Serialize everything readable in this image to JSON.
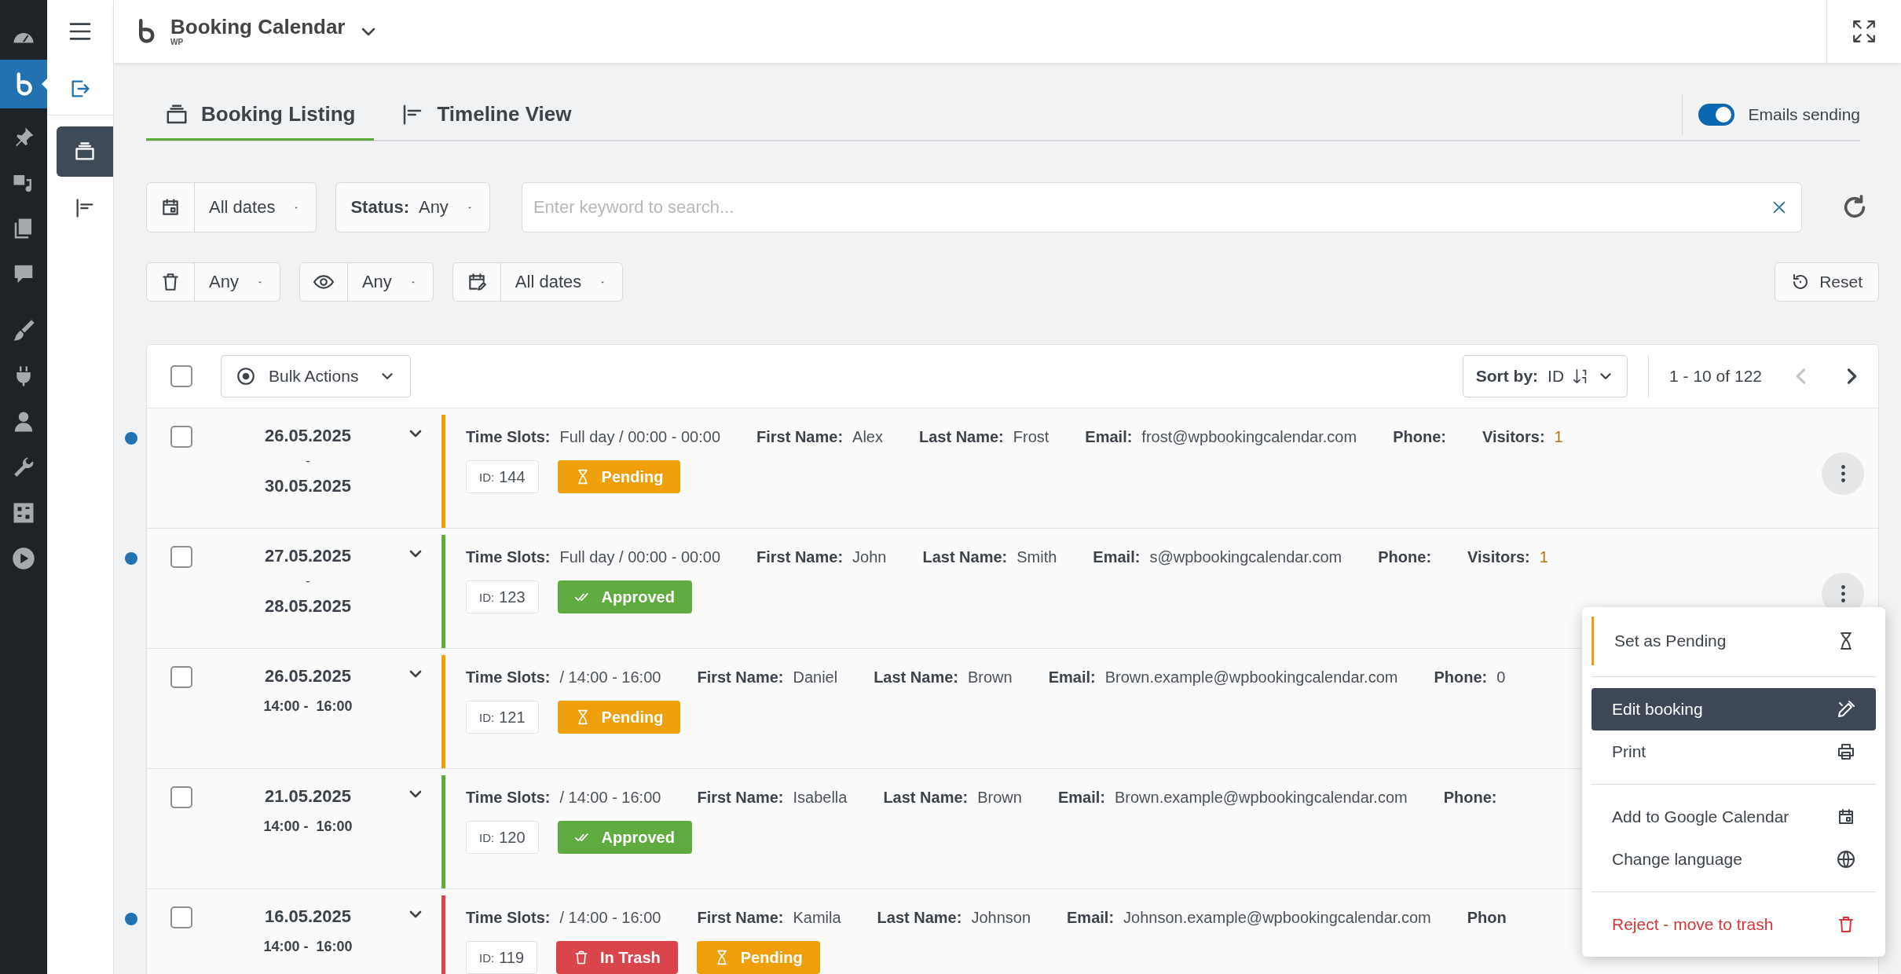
{
  "wp_menu": [
    {
      "selected": false
    },
    {
      "selected": true
    },
    {
      "selected": false
    },
    {
      "selected": false
    },
    {
      "selected": false
    },
    {
      "selected": false
    },
    {
      "selected": false
    },
    {
      "selected": false
    },
    {
      "selected": false
    },
    {
      "selected": false
    },
    {
      "selected": false
    },
    {
      "selected": false
    }
  ],
  "side_menu": [
    {
      "selected": false
    },
    {
      "selected": true
    },
    {
      "selected": false
    }
  ],
  "header": {
    "title": "Booking Calendar",
    "subtitle": "WP"
  },
  "tabs": [
    {
      "label": "Booking Listing",
      "selected": true
    },
    {
      "label": "Timeline View",
      "selected": false
    }
  ],
  "emails_toggle": {
    "label": "Emails sending",
    "on": true
  },
  "filters": {
    "dates": "All dates",
    "status_label": "Status:",
    "status": "Any",
    "search": {
      "placeholder": "Enter keyword to search..."
    },
    "trash": "Any",
    "read": "Any",
    "modified": "All dates",
    "reset": "Reset"
  },
  "list": {
    "select_all_checked": false,
    "bulk_actions": "Bulk Actions",
    "sort_label": "Sort by:",
    "sort_value": "ID",
    "pagination": "1 - 10 of 122",
    "rows": [
      {
        "unread": true,
        "checked": false,
        "kind": "range",
        "date": "26.05.2025",
        "separator": "-",
        "end": "30.05.2025",
        "color": "#ef9f0b",
        "fields": [
          {
            "label": "Time Slots:",
            "value": "Full day / 00:00 - 00:00"
          },
          {
            "label": "First Name:",
            "value": "Alex"
          },
          {
            "label": "Last Name:",
            "value": "Frost"
          },
          {
            "label": "Email:",
            "value": "frost@wpbookingcalendar.com"
          },
          {
            "label": "Phone:"
          },
          {
            "label": "Visitors:",
            "value": "1"
          }
        ],
        "id_label": "ID:",
        "id": "144",
        "badges": [
          {
            "label": "Pending",
            "kind": "pending"
          }
        ],
        "more_button": true
      },
      {
        "unread": true,
        "checked": false,
        "kind": "range",
        "date": "27.05.2025",
        "separator": "-",
        "end": "28.05.2025",
        "color": "#5fab3f",
        "fields": [
          {
            "label": "Time Slots:",
            "value": "Full day / 00:00 - 00:00"
          },
          {
            "label": "First Name:",
            "value": "John"
          },
          {
            "label": "Last Name:",
            "value": "Smith"
          },
          {
            "label": "Email:",
            "value": "s@wpbookingcalendar.com"
          },
          {
            "label": "Phone:"
          },
          {
            "label": "Visitors:",
            "value": "1"
          }
        ],
        "id_label": "ID:",
        "id": "123",
        "badges": [
          {
            "label": "Approved",
            "kind": "approved"
          }
        ],
        "more_button": true
      },
      {
        "unread": false,
        "checked": false,
        "kind": "single",
        "date": "26.05.2025",
        "time": "14:00 -  16:00",
        "color": "#ef9f0b",
        "fields": [
          {
            "label": "Time Slots:",
            "value": "/ 14:00 - 16:00"
          },
          {
            "label": "First Name:",
            "value": "Daniel"
          },
          {
            "label": "Last Name:",
            "value": "Brown"
          },
          {
            "label": "Email:",
            "value": "Brown.example@wpbookingcalendar.com"
          },
          {
            "label": "Phone:",
            "value": "0"
          }
        ],
        "id_label": "ID:",
        "id": "121",
        "badges": [
          {
            "label": "Pending",
            "kind": "pending"
          }
        ],
        "more_button": false
      },
      {
        "unread": false,
        "checked": false,
        "kind": "single",
        "date": "21.05.2025",
        "time": "14:00 -  16:00",
        "color": "#5fab3f",
        "fields": [
          {
            "label": "Time Slots:",
            "value": "/ 14:00 - 16:00"
          },
          {
            "label": "First Name:",
            "value": "Isabella"
          },
          {
            "label": "Last Name:",
            "value": "Brown"
          },
          {
            "label": "Email:",
            "value": "Brown.example@wpbookingcalendar.com"
          },
          {
            "label": "Phone:"
          }
        ],
        "id_label": "ID:",
        "id": "120",
        "badges": [
          {
            "label": "Approved",
            "kind": "approved"
          }
        ],
        "more_button": false
      },
      {
        "unread": true,
        "checked": false,
        "kind": "single",
        "date": "16.05.2025",
        "time": "14:00 -  16:00",
        "color": "#d9454a",
        "fields": [
          {
            "label": "Time Slots:",
            "value": "/ 14:00 - 16:00"
          },
          {
            "label": "First Name:",
            "value": "Kamila"
          },
          {
            "label": "Last Name:",
            "value": "Johnson"
          },
          {
            "label": "Email:",
            "value": "Johnson.example@wpbookingcalendar.com"
          },
          {
            "label": "Phon"
          }
        ],
        "id_label": "ID:",
        "id": "119",
        "badges": [
          {
            "label": "In Trash",
            "kind": "trash"
          },
          {
            "label": "Pending",
            "kind": "pending"
          }
        ],
        "more_button": false
      }
    ]
  },
  "menu": {
    "groups": [
      [
        {
          "label": "Set as Pending",
          "kind": "status",
          "selected": false
        }
      ],
      [
        {
          "label": "Edit booking",
          "kind": "action",
          "selected": true
        },
        {
          "label": "Print",
          "kind": "action",
          "selected": false
        }
      ],
      [
        {
          "label": "Add to Google Calendar",
          "kind": "action",
          "selected": false
        },
        {
          "label": "Change language",
          "kind": "action",
          "selected": false
        }
      ],
      [
        {
          "label": "Reject - move to trash",
          "kind": "danger",
          "selected": false
        }
      ]
    ]
  }
}
